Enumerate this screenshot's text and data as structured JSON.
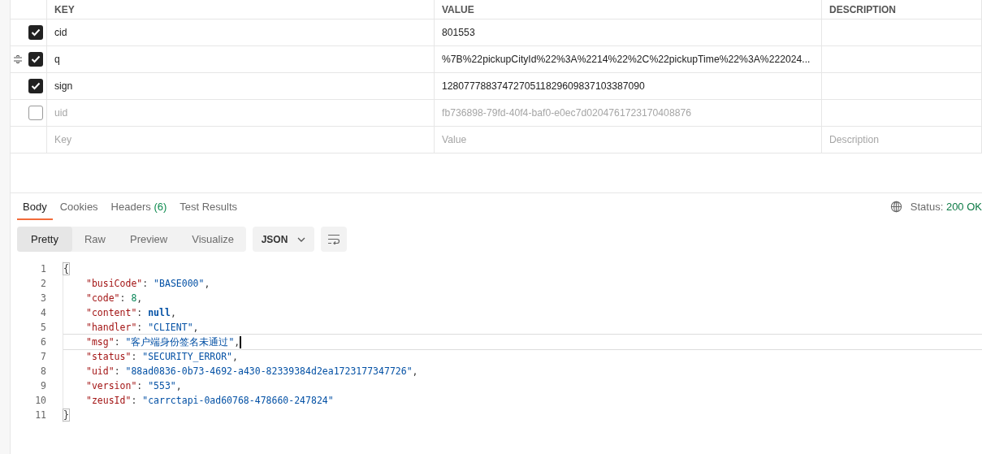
{
  "params": {
    "columns": [
      "KEY",
      "VALUE",
      "DESCRIPTION"
    ],
    "rows": [
      {
        "key": "cid",
        "value": "801553",
        "checked": true,
        "hovered": false
      },
      {
        "key": "q",
        "value": "%7B%22pickupCityId%22%3A%2214%22%2C%22pickupTime%22%3A%222024...",
        "checked": true,
        "hovered": true
      },
      {
        "key": "sign",
        "value": "1280777883747270511829609837103387090",
        "checked": true,
        "hovered": false
      },
      {
        "key": "uid",
        "value": "fb736898-79fd-40f4-baf0-e0ec7d0204761723170408876",
        "checked": false,
        "hovered": false
      }
    ],
    "new_row": {
      "key_placeholder": "Key",
      "value_placeholder": "Value",
      "description_placeholder": "Description"
    }
  },
  "response": {
    "tabs": [
      {
        "label": "Body",
        "selected": true
      },
      {
        "label": "Cookies",
        "selected": false
      },
      {
        "label": "Headers",
        "count": "(6)",
        "selected": false
      },
      {
        "label": "Test Results",
        "selected": false
      }
    ],
    "status_label": "Status:",
    "status_value": "200 OK",
    "views": [
      {
        "label": "Pretty",
        "selected": true
      },
      {
        "label": "Raw",
        "selected": false
      },
      {
        "label": "Preview",
        "selected": false
      },
      {
        "label": "Visualize",
        "selected": false
      }
    ],
    "format": "JSON",
    "code": [
      {
        "number": "1",
        "current": false,
        "tokens": [
          {
            "kind": "brace",
            "text": "{"
          }
        ]
      },
      {
        "number": "2",
        "current": false,
        "tokens": [
          {
            "kind": "key",
            "text": "\"busiCode\""
          },
          {
            "kind": "punct",
            "text": ": "
          },
          {
            "kind": "string",
            "text": "\"BASE000\""
          },
          {
            "kind": "punct",
            "text": ","
          }
        ]
      },
      {
        "number": "3",
        "current": false,
        "tokens": [
          {
            "kind": "key",
            "text": "\"code\""
          },
          {
            "kind": "punct",
            "text": ": "
          },
          {
            "kind": "number",
            "text": "8"
          },
          {
            "kind": "punct",
            "text": ","
          }
        ]
      },
      {
        "number": "4",
        "current": false,
        "tokens": [
          {
            "kind": "key",
            "text": "\"content\""
          },
          {
            "kind": "punct",
            "text": ": "
          },
          {
            "kind": "null",
            "text": "null"
          },
          {
            "kind": "punct",
            "text": ","
          }
        ]
      },
      {
        "number": "5",
        "current": false,
        "tokens": [
          {
            "kind": "key",
            "text": "\"handler\""
          },
          {
            "kind": "punct",
            "text": ": "
          },
          {
            "kind": "string",
            "text": "\"CLIENT\""
          },
          {
            "kind": "punct",
            "text": ","
          }
        ]
      },
      {
        "number": "6",
        "current": true,
        "tokens": [
          {
            "kind": "key",
            "text": "\"msg\""
          },
          {
            "kind": "punct",
            "text": ": "
          },
          {
            "kind": "string",
            "text": "\"客户端身份签名未通过\""
          },
          {
            "kind": "punct",
            "text": ","
          }
        ]
      },
      {
        "number": "7",
        "current": false,
        "tokens": [
          {
            "kind": "key",
            "text": "\"status\""
          },
          {
            "kind": "punct",
            "text": ": "
          },
          {
            "kind": "string",
            "text": "\"SECURITY_ERROR\""
          },
          {
            "kind": "punct",
            "text": ","
          }
        ]
      },
      {
        "number": "8",
        "current": false,
        "tokens": [
          {
            "kind": "key",
            "text": "\"uid\""
          },
          {
            "kind": "punct",
            "text": ": "
          },
          {
            "kind": "string",
            "text": "\"88ad0836-0b73-4692-a430-82339384d2ea1723177347726\""
          },
          {
            "kind": "punct",
            "text": ","
          }
        ]
      },
      {
        "number": "9",
        "current": false,
        "tokens": [
          {
            "kind": "key",
            "text": "\"version\""
          },
          {
            "kind": "punct",
            "text": ": "
          },
          {
            "kind": "string",
            "text": "\"553\""
          },
          {
            "kind": "punct",
            "text": ","
          }
        ]
      },
      {
        "number": "10",
        "current": false,
        "tokens": [
          {
            "kind": "key",
            "text": "\"zeusId\""
          },
          {
            "kind": "punct",
            "text": ": "
          },
          {
            "kind": "string",
            "text": "\"carrctapi-0ad60768-478660-247824\""
          }
        ]
      },
      {
        "number": "11",
        "current": false,
        "tokens": [
          {
            "kind": "brace",
            "text": "}"
          }
        ]
      }
    ]
  }
}
